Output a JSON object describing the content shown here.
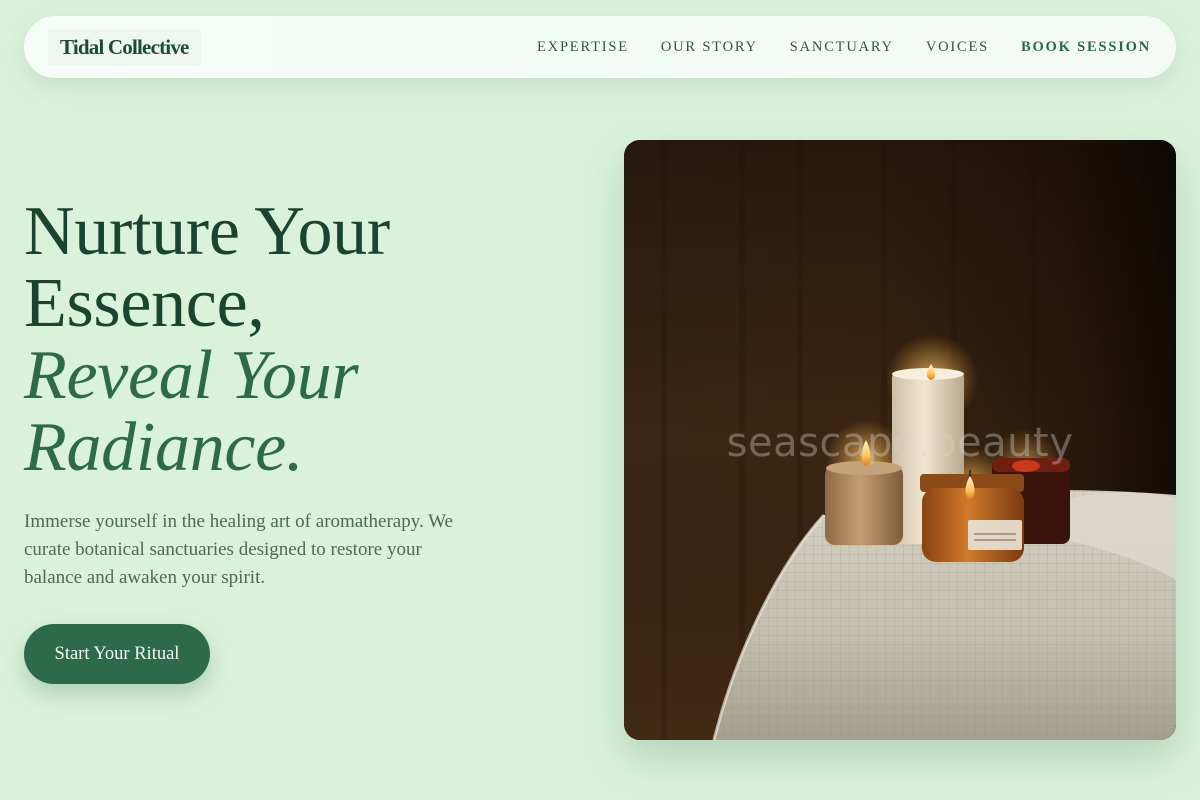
{
  "brand": {
    "name": "Tidal Collective"
  },
  "nav": {
    "links": [
      {
        "label": "EXPERTISE"
      },
      {
        "label": "OUR STORY"
      },
      {
        "label": "SANCTUARY"
      },
      {
        "label": "VOICES"
      },
      {
        "label": "BOOK SESSION"
      }
    ]
  },
  "hero": {
    "title_lines": [
      "Nurture Your",
      "Essence,"
    ],
    "title_italic_lines": [
      "Reveal Your",
      "Radiance."
    ],
    "description": "Immerse yourself in the healing art of aromatherapy. We curate botanical sanctuaries designed to restore your balance and awaken your spirit.",
    "cta_label": "Start Your Ritual",
    "image": {
      "subject": "candles-on-draped-table",
      "watermark": "seascape.beauty"
    }
  },
  "colors": {
    "background": "#daf2da",
    "accent": "#2d6a4b",
    "heading": "#1b4430"
  }
}
